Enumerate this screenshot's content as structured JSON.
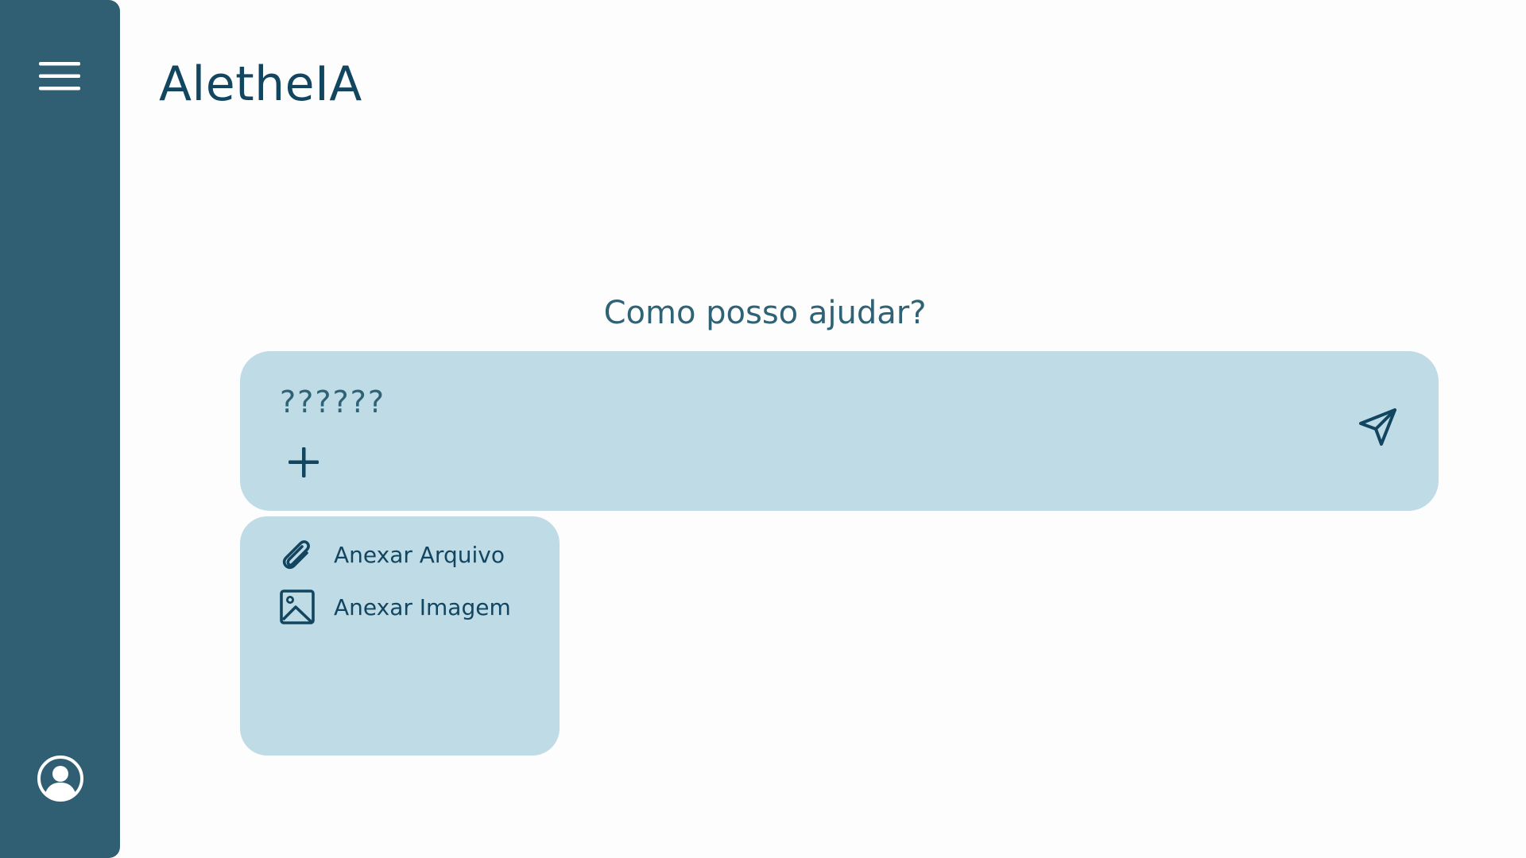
{
  "app": {
    "title": "AletheIA"
  },
  "sidebar": {
    "menu_icon": "hamburger-menu-icon",
    "profile_icon": "user-circle-icon"
  },
  "main": {
    "heading": "Como posso ajudar?"
  },
  "chat": {
    "input_value": "??????",
    "plus_icon": "plus-icon",
    "send_icon": "send-paper-plane-icon"
  },
  "attach_menu": {
    "items": [
      {
        "label": "Anexar Arquivo",
        "icon": "paperclip-icon"
      },
      {
        "label": "Anexar Imagem",
        "icon": "image-icon"
      }
    ]
  },
  "colors": {
    "sidebar": "#305f74",
    "background": "#fdfdfd",
    "panel": "#bfdbe6",
    "text_dark": "#124660",
    "text_muted": "#2f6275"
  }
}
